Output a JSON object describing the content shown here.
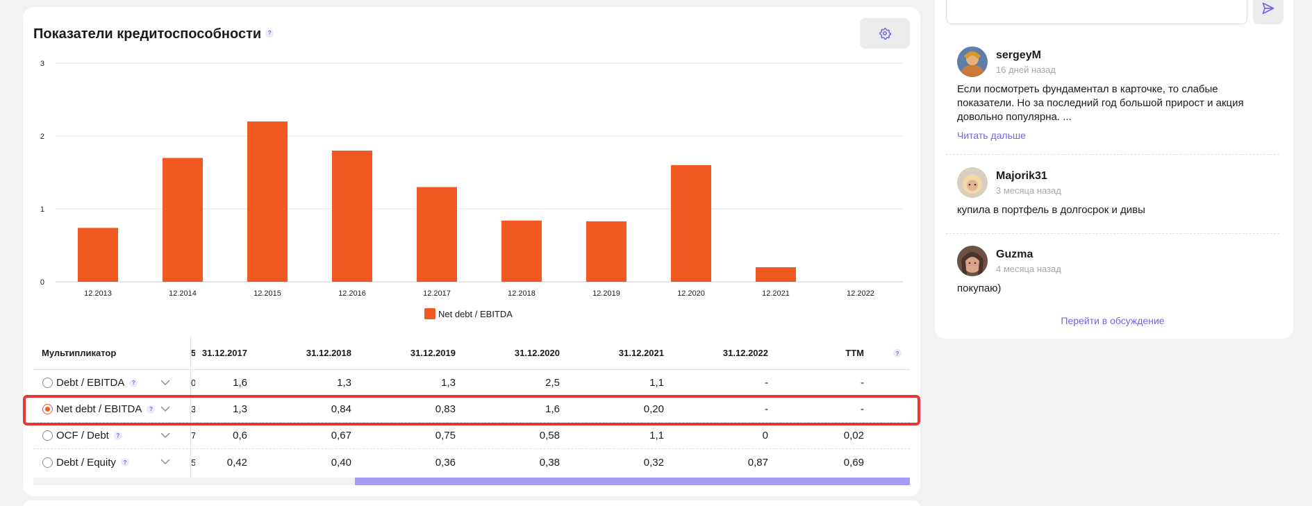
{
  "credit": {
    "title": "Показатели кредитоспособности",
    "help": "?",
    "settings_icon": "gear-icon"
  },
  "chart_data": {
    "type": "bar",
    "title": "",
    "xlabel": "",
    "ylabel": "",
    "categories": [
      "12.2013",
      "12.2014",
      "12.2015",
      "12.2016",
      "12.2017",
      "12.2018",
      "12.2019",
      "12.2020",
      "12.2021",
      "12.2022"
    ],
    "series": [
      {
        "name": "Net debt / EBITDA",
        "values": [
          0.74,
          1.7,
          2.2,
          1.8,
          1.3,
          0.84,
          0.83,
          1.6,
          0.2,
          null
        ],
        "color": "#f05a22"
      }
    ],
    "ylim": [
      0,
      3
    ],
    "yticks": [
      "0",
      "1",
      "2",
      "3"
    ],
    "grid": true,
    "legend": "bottom"
  },
  "table": {
    "header": {
      "label": "Мультипликатор",
      "cut": "5",
      "columns": [
        "31.12.2017",
        "31.12.2018",
        "31.12.2019",
        "31.12.2020",
        "31.12.2021",
        "31.12.2022",
        "TTM"
      ]
    },
    "rows": [
      {
        "label": "Debt / EBITDA",
        "cut": "0",
        "values": [
          "1,6",
          "1,3",
          "1,3",
          "2,5",
          "1,1",
          "-",
          "-"
        ],
        "selected": false
      },
      {
        "label": "Net debt / EBITDA",
        "cut": "3",
        "values": [
          "1,3",
          "0,84",
          "0,83",
          "1,6",
          "0,20",
          "-",
          "-"
        ],
        "selected": true
      },
      {
        "label": "OCF / Debt",
        "cut": "7",
        "values": [
          "0,6",
          "0,67",
          "0,75",
          "0,58",
          "1,1",
          "0",
          "0,02"
        ],
        "selected": false
      },
      {
        "label": "Debt / Equity",
        "cut": "5",
        "values": [
          "0,42",
          "0,40",
          "0,36",
          "0,38",
          "0,32",
          "0,87",
          "0,69"
        ],
        "selected": false
      }
    ]
  },
  "discussion": {
    "send_icon": "send-icon",
    "comments": [
      {
        "user": "sergeyM",
        "time": "16 дней назад",
        "text": "Если посмотреть фундаментал в карточке, то слабые показатели. Но за последний год большой прирост и акция довольно популярна. ...",
        "more": "Читать дальше"
      },
      {
        "user": "Majorik31",
        "time": "3 месяца назад",
        "text": "купила в портфель в долгосрок и дивы"
      },
      {
        "user": "Guzma",
        "time": "4 месяца назад",
        "text": "покупаю)"
      }
    ],
    "go_to_discussion": "Перейти в обсуждение"
  }
}
